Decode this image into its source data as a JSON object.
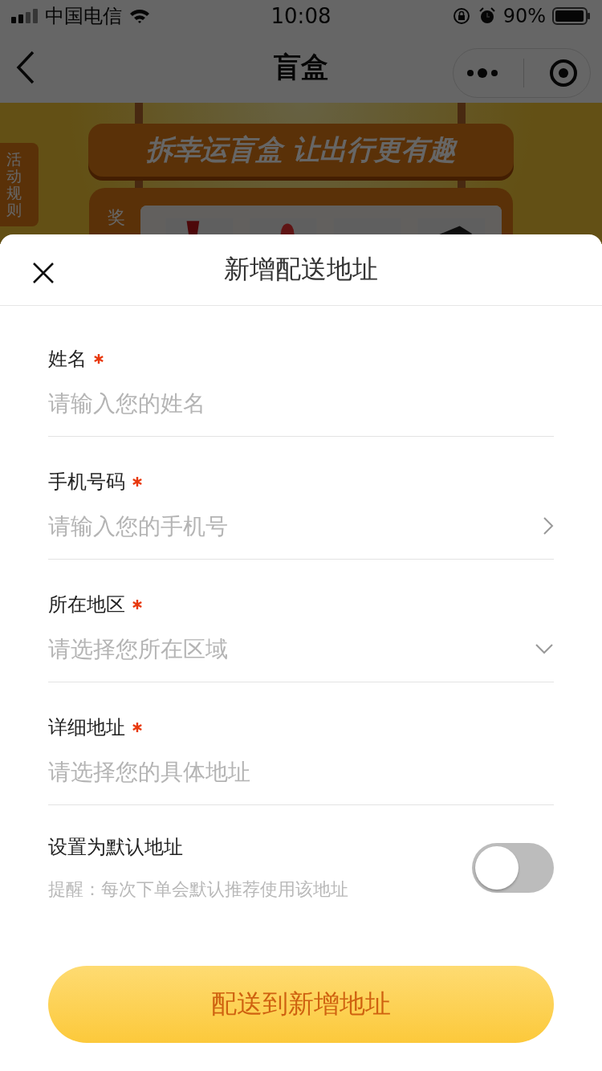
{
  "status_bar": {
    "carrier": "中国电信",
    "time": "10:08",
    "battery": "90%"
  },
  "nav_bar": {
    "title": "盲盒"
  },
  "banner": {
    "headline": "拆幸运盲盒 让出行更有趣",
    "rules_tab": "活动规则",
    "prize_label": "奖"
  },
  "sheet": {
    "title": "新增配送地址",
    "fields": [
      {
        "label": "姓名",
        "required": true,
        "placeholder": "请输入您的姓名",
        "kind": "text"
      },
      {
        "label": "手机号码",
        "required": true,
        "placeholder": "请输入您的手机号",
        "kind": "arrow"
      },
      {
        "label": "所在地区",
        "required": true,
        "placeholder": "请选择您所在区域",
        "kind": "dropdown"
      },
      {
        "label": "详细地址",
        "required": true,
        "placeholder": "请选择您的具体地址",
        "kind": "text"
      }
    ],
    "default_address": {
      "label": "设置为默认地址",
      "hint": "提醒：每次下单会默认推荐使用该地址",
      "on": false
    },
    "submit": "配送到新增地址"
  }
}
